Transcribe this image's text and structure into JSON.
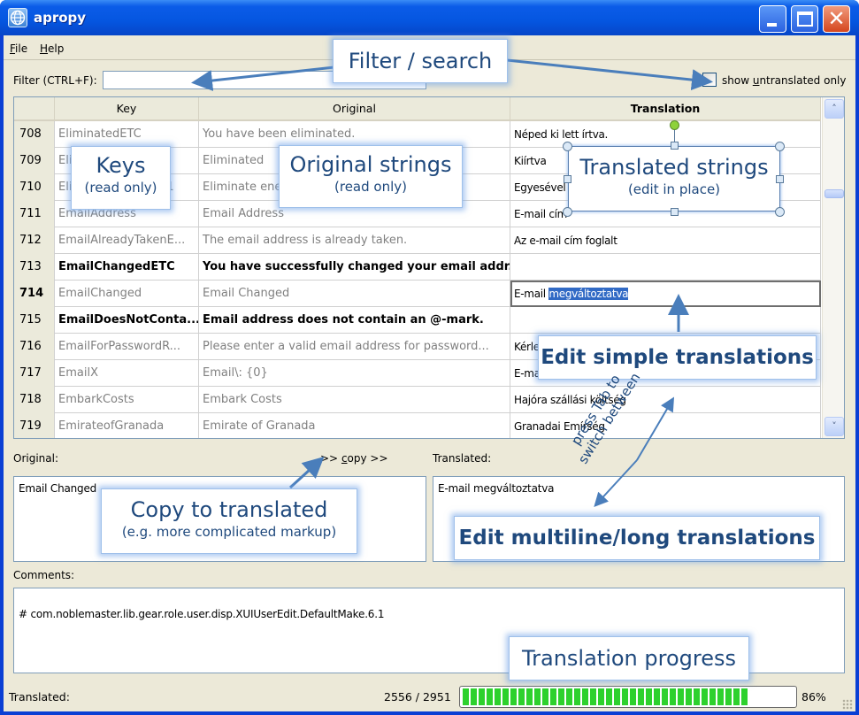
{
  "window": {
    "title": "apropy",
    "app_icon": "globe-icon",
    "controls": {
      "minimize": "minimize-icon",
      "maximize": "maximize-icon",
      "close": "close-icon",
      "close_glyph": "✕"
    }
  },
  "menu": [
    {
      "label_ul": "F",
      "label_rest": "ile"
    },
    {
      "label_ul": "H",
      "label_rest": "elp"
    }
  ],
  "filter": {
    "label": "Filter (CTRL+F):",
    "value": "",
    "placeholder": ""
  },
  "untranslated_toggle": {
    "label_pre": "show ",
    "label_ul": "u",
    "label_post": "ntranslated only",
    "checked": false
  },
  "table": {
    "columns": [
      "",
      "Key",
      "Original",
      "Translation"
    ],
    "rows": [
      {
        "num": "708",
        "key": "EliminatedETC",
        "original": "You have been eliminated.",
        "translation": "Néped ki lett írtva.",
        "style": "grey"
      },
      {
        "num": "709",
        "key": "Eliminated",
        "original": "Eliminated",
        "translation": "Kiírtva",
        "style": "grey"
      },
      {
        "num": "710",
        "key": "EliminateEnemyBy1",
        "original": "Eliminate enemy by 1",
        "translation": "Egyesével",
        "style": "grey"
      },
      {
        "num": "711",
        "key": "EmailAddress",
        "original": "Email Address",
        "translation": "E-mail cím",
        "style": "grey"
      },
      {
        "num": "712",
        "key": "EmailAlreadyTakenE...",
        "original": "The email address is already taken.",
        "translation": "Az e-mail cím foglalt",
        "style": "grey"
      },
      {
        "num": "713",
        "key": "EmailChangedETC",
        "original": "You have successfully changed your email addr...",
        "translation": "",
        "style": "bold"
      },
      {
        "num": "714",
        "key": "EmailChanged",
        "original": "Email Changed",
        "translation_plain": "E-mail ",
        "translation_selected": "megváltoztatva",
        "style": "grey",
        "editing": true
      },
      {
        "num": "715",
        "key": "EmailDoesNotConta...",
        "original": "Email address does not contain an @-mark.",
        "translation": "",
        "style": "bold"
      },
      {
        "num": "716",
        "key": "EmailForPasswordR...",
        "original": "Please enter a valid email address for password...",
        "translation": "Kérlek",
        "style": "grey"
      },
      {
        "num": "717",
        "key": "EmailX",
        "original": "Email\\: {0}",
        "translation": "E-mail\\: {0}",
        "style": "grey"
      },
      {
        "num": "718",
        "key": "EmbarkCosts",
        "original": "Embark Costs",
        "translation": "Hajóra szállási költség",
        "style": "grey"
      },
      {
        "num": "719",
        "key": "EmirateofGranada",
        "original": "Emirate of Granada",
        "translation": "Granadai Emírség",
        "style": "grey"
      }
    ],
    "scroll_up_glyph": "˄",
    "scroll_down_glyph": "˅"
  },
  "detail": {
    "original_label": "Original:",
    "copy_pre": ">> ",
    "copy_ul": "c",
    "copy_post": "opy >>",
    "translated_label": "Translated:",
    "original_text": "Email Changed",
    "translated_text": "E-mail megváltoztatva",
    "comments_label": "Comments:",
    "comments_text": "# com.noblemaster.lib.gear.role.user.disp.XUIUserEdit.DefaultMake.6.1"
  },
  "status": {
    "label": "Translated:",
    "translated": 2556,
    "total": 2951,
    "count_text": "2556 / 2951",
    "progress_fraction": 0.86,
    "percent_text": "86%"
  },
  "annotations": {
    "filter": "Filter / search",
    "keys_title": "Keys",
    "keys_sub": "(read only)",
    "original_title": "Original strings",
    "original_sub": "(read only)",
    "translated_title": "Translated strings",
    "translated_sub": "(edit in place)",
    "edit_simple": "Edit simple translations",
    "tab_note": "press Tab to switch between",
    "copy_title": "Copy to translated",
    "copy_sub": "(e.g. more complicated markup)",
    "edit_multiline": "Edit multiline/long translations",
    "progress": "Translation progress",
    "accent_color": "#1f497d",
    "arrow_color": "#4a7ebb"
  }
}
